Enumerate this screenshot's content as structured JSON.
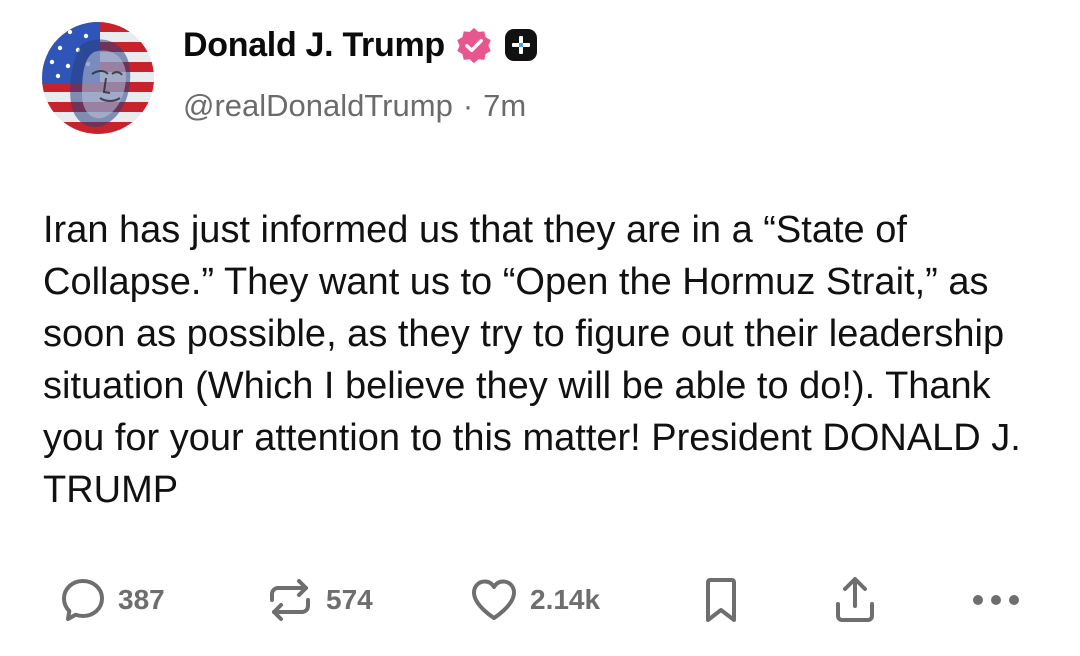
{
  "author": {
    "display_name": "Donald J. Trump",
    "handle": "@realDonaldTrump",
    "separator": "·",
    "time_ago": "7m",
    "verified_color": "#e8568f",
    "avatar_description_icon": "flag-portrait-avatar"
  },
  "post": {
    "text": "Iran has just informed us that they are in a “State of Collapse.” They want us to “Open the Hormuz Strait,” as soon as possible, as they try to figure out their leadership situation (Which I believe they will be able to do!). Thank you for your attention to this matter! President DONALD J. TRUMP"
  },
  "actions": {
    "reply_count": "387",
    "repost_count": "574",
    "like_count": "2.14k",
    "icon_color": "#6e6e6e",
    "icons": [
      "reply-icon",
      "repost-icon",
      "heart-icon",
      "bookmark-icon",
      "share-icon",
      "more-icon"
    ]
  }
}
